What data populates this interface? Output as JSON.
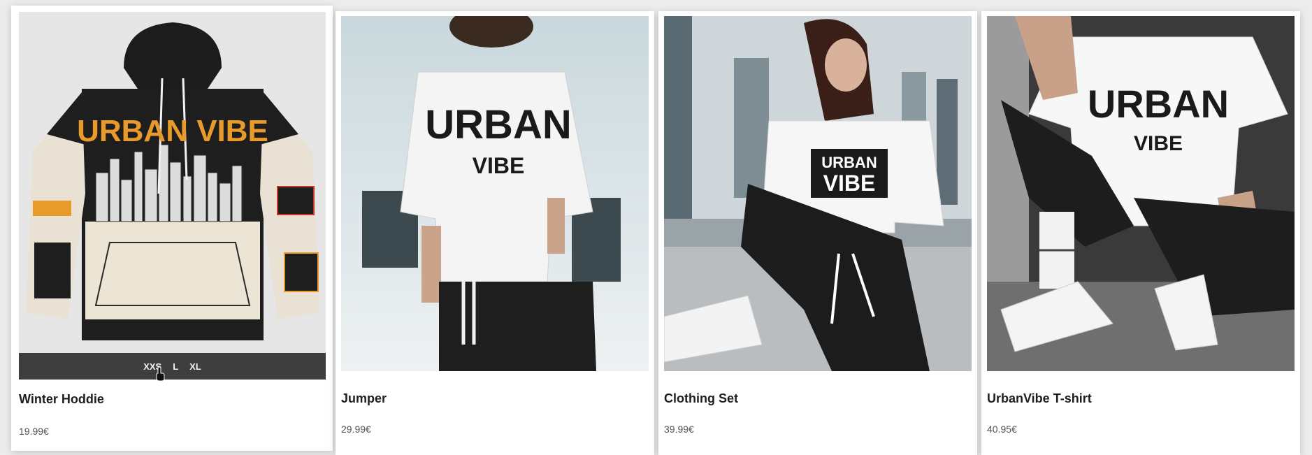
{
  "products": [
    {
      "name": "Winter Hoddie",
      "price": "19.99€",
      "image_print": "URBAN VIBE",
      "image_icon": "hoodie-product-image",
      "sizes": [
        "XXS",
        "L",
        "XL"
      ]
    },
    {
      "name": "Jumper",
      "price": "29.99€",
      "image_print_top": "URBAN",
      "image_print_bottom": "VIBE",
      "image_icon": "jumper-product-image"
    },
    {
      "name": "Clothing Set",
      "price": "39.99€",
      "image_print_top": "URBAN",
      "image_print_bottom": "VIBE",
      "image_icon": "clothing-set-product-image"
    },
    {
      "name": "UrbanVibe T-shirt",
      "price": "40.95€",
      "image_print_top": "URBAN",
      "image_print_bottom": "VIBE",
      "image_icon": "tshirt-product-image"
    }
  ],
  "colors": {
    "page_bg": "#ececec",
    "card_bg": "#ffffff",
    "size_bar": "#303030",
    "print_orange": "#e89a2a"
  }
}
